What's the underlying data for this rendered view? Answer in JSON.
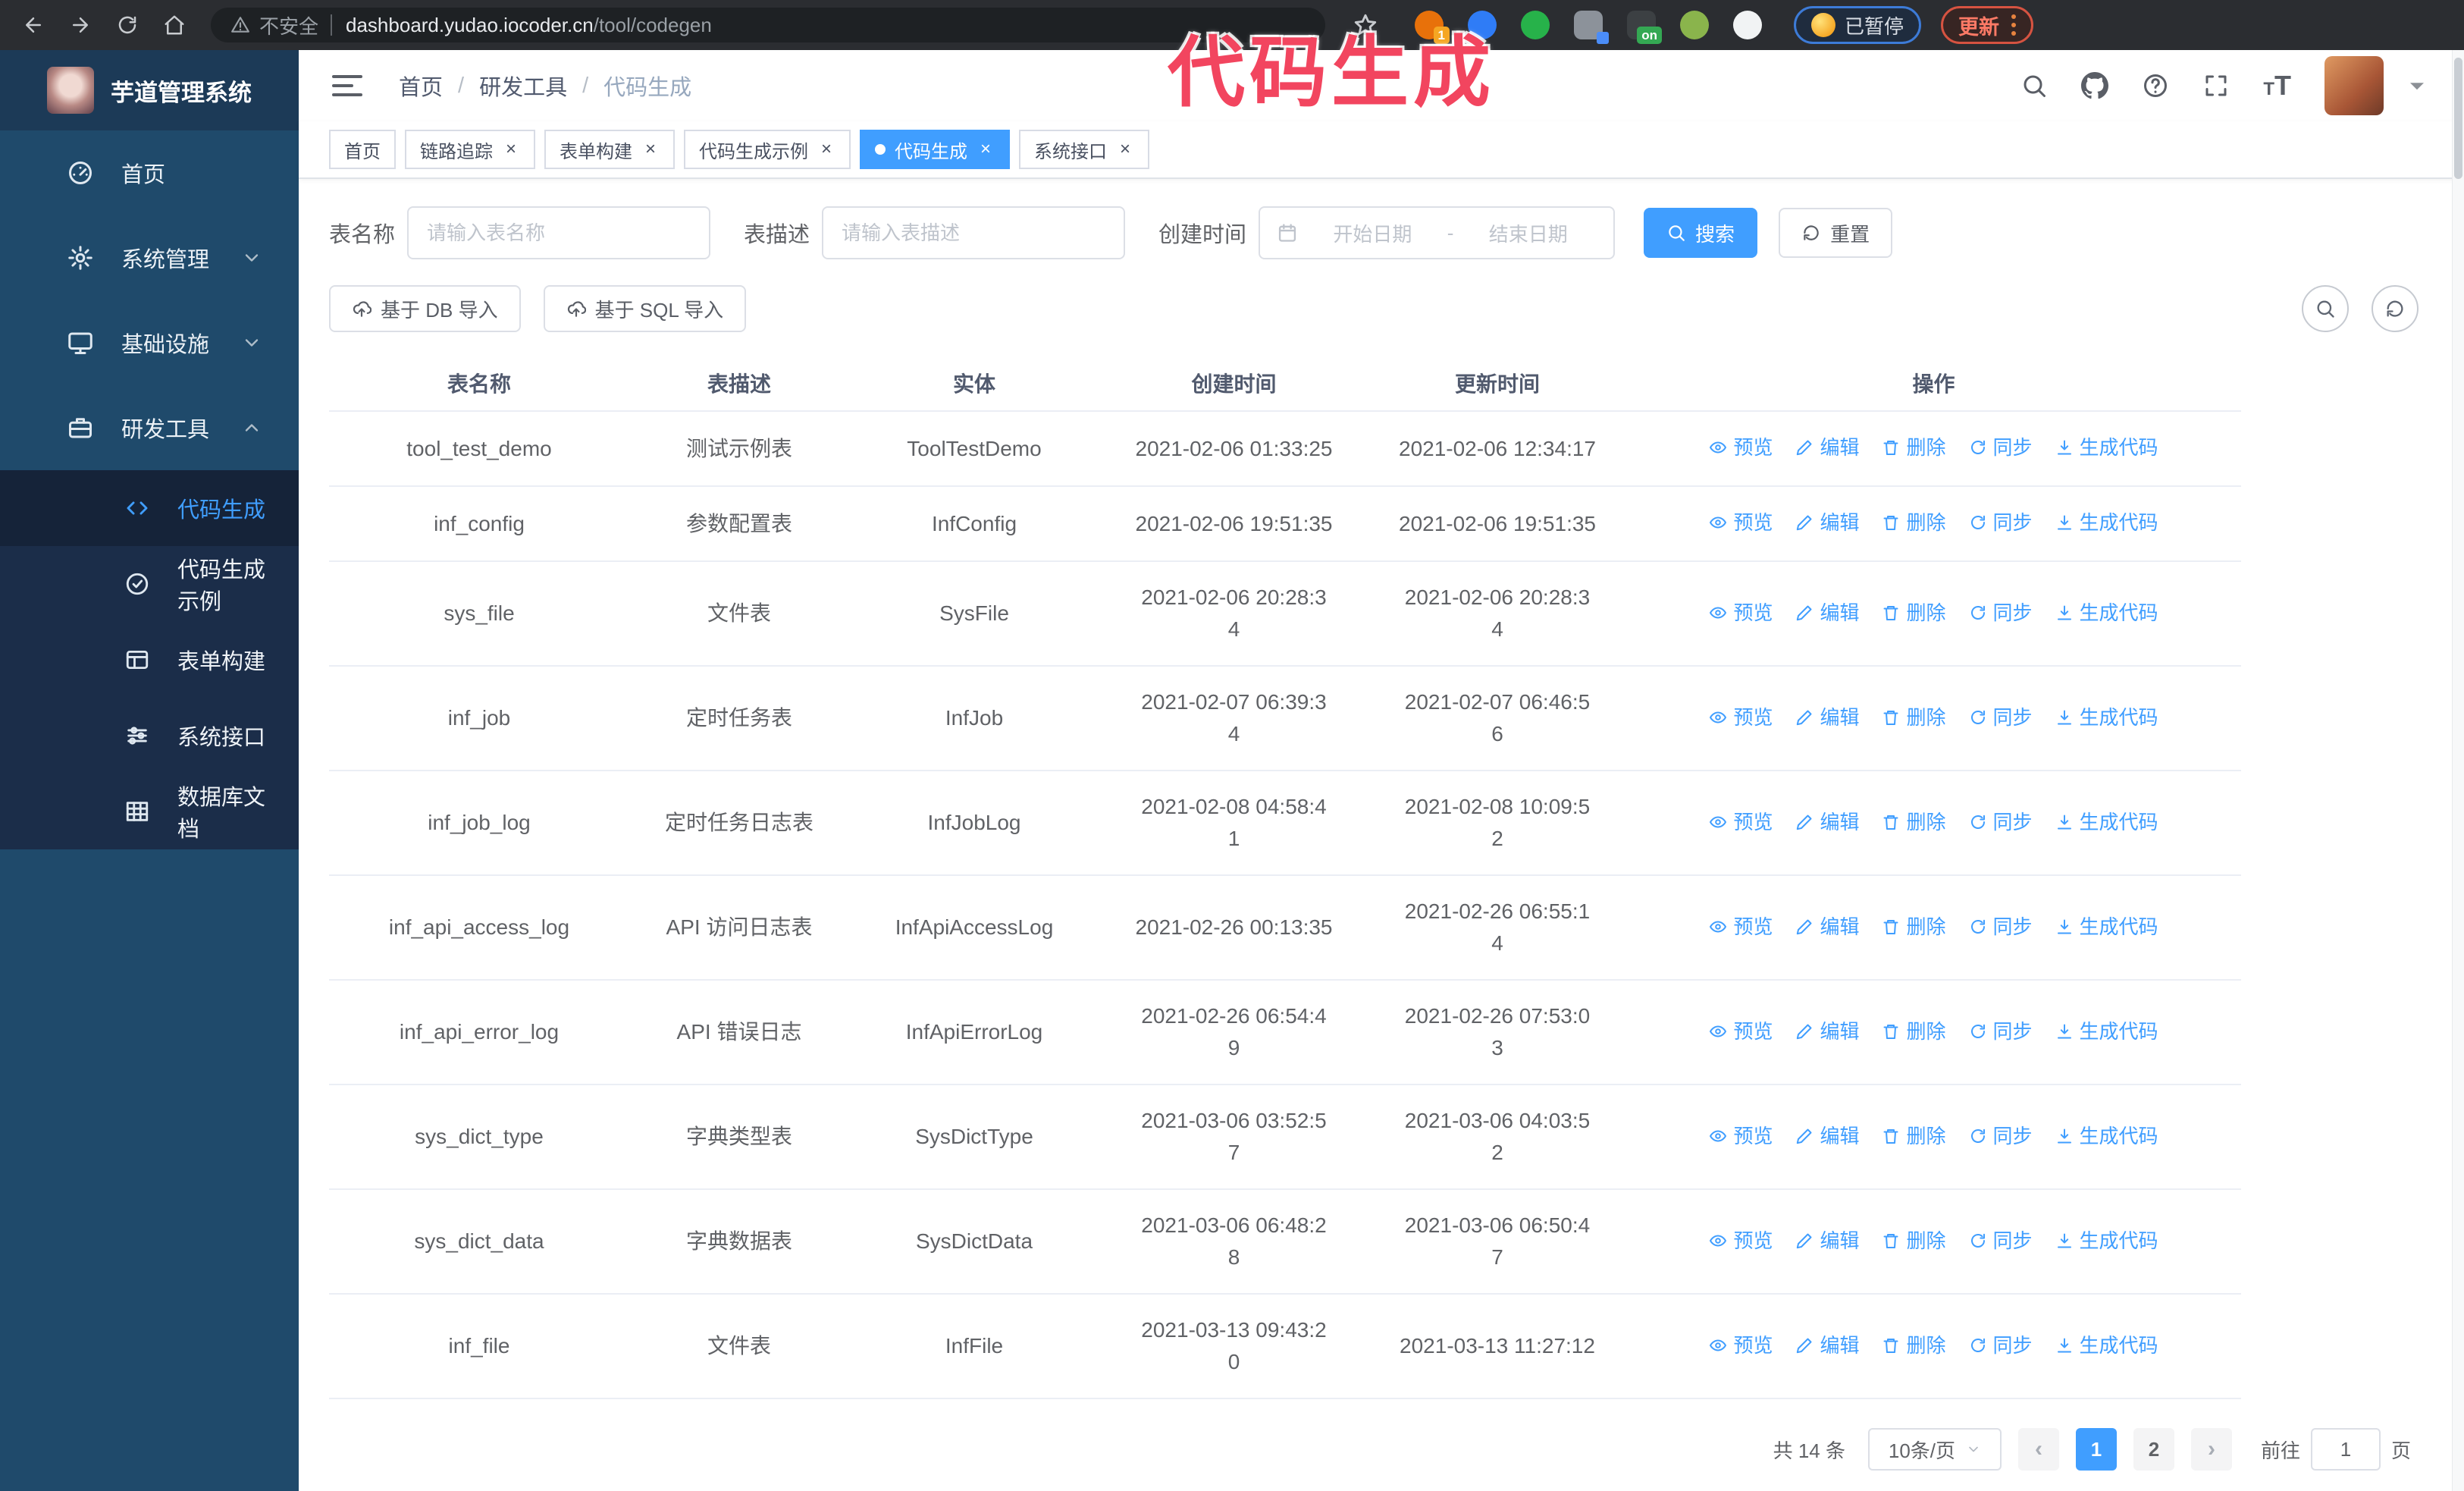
{
  "browser": {
    "security_label": "不安全",
    "url_domain": "dashboard.yudao.iocoder.cn",
    "url_path": "/tool/codegen",
    "paused_badge": "已暂停",
    "update_button": "更新",
    "extensions": [
      {
        "name": "browser-extension-orange-icon",
        "color": "#e8710a",
        "shape": "round",
        "badge": "1",
        "badge_color": "#f5a623"
      },
      {
        "name": "browser-extension-gem-icon",
        "color": "#2f7cf6",
        "shape": "round"
      },
      {
        "name": "browser-extension-green-circle-icon",
        "color": "#27b24a",
        "shape": "round"
      },
      {
        "name": "browser-extension-grid-icon",
        "color": "#8c929a",
        "shape": "square",
        "badge": "",
        "badge_color": "#4b8df8"
      },
      {
        "name": "browser-extension-dark-icon",
        "color": "#3c4043",
        "shape": "square",
        "badge": "on",
        "badge_color": "#34a853"
      },
      {
        "name": "browser-extension-green-monkey-icon",
        "color": "#8ab44c",
        "shape": "round"
      },
      {
        "name": "browser-extension-white-icon",
        "color": "#f1f3f4",
        "shape": "round"
      }
    ]
  },
  "overlay": {
    "text": "代码生成",
    "color": "#f2455f"
  },
  "app": {
    "logo_title": "芋道管理系统",
    "breadcrumb": [
      "首页",
      "研发工具",
      "代码生成"
    ],
    "sidebar": {
      "items": [
        {
          "label": "首页",
          "icon": "gauge-icon"
        },
        {
          "label": "系统管理",
          "icon": "gear-icon",
          "chevron": "down"
        },
        {
          "label": "基础设施",
          "icon": "monitor-icon",
          "chevron": "down"
        },
        {
          "label": "研发工具",
          "icon": "toolbox-icon",
          "chevron": "up",
          "children": [
            {
              "label": "代码生成",
              "icon": "code-icon",
              "active": true
            },
            {
              "label": "代码生成示例",
              "icon": "badge-check-icon"
            },
            {
              "label": "表单构建",
              "icon": "form-icon"
            },
            {
              "label": "系统接口",
              "icon": "sliders-icon"
            },
            {
              "label": "数据库文档",
              "icon": "table-grid-icon"
            }
          ]
        }
      ]
    },
    "tags": [
      {
        "label": "首页",
        "closable": false,
        "active": false
      },
      {
        "label": "链路追踪",
        "closable": true,
        "active": false
      },
      {
        "label": "表单构建",
        "closable": true,
        "active": false
      },
      {
        "label": "代码生成示例",
        "closable": true,
        "active": false
      },
      {
        "label": "代码生成",
        "closable": true,
        "active": true
      },
      {
        "label": "系统接口",
        "closable": true,
        "active": false
      }
    ],
    "search_form": {
      "table_name_label": "表名称",
      "table_name_placeholder": "请输入表名称",
      "table_desc_label": "表描述",
      "table_desc_placeholder": "请输入表描述",
      "create_time_label": "创建时间",
      "start_placeholder": "开始日期",
      "range_separator": "-",
      "end_placeholder": "结束日期",
      "search_button": "搜索",
      "reset_button": "重置"
    },
    "toolbar": {
      "import_db": "基于 DB 导入",
      "import_sql": "基于 SQL 导入"
    },
    "table": {
      "columns": [
        "表名称",
        "表描述",
        "实体",
        "创建时间",
        "更新时间",
        "操作"
      ],
      "actions": [
        {
          "label": "预览",
          "icon": "eye-icon"
        },
        {
          "label": "编辑",
          "icon": "edit-icon"
        },
        {
          "label": "删除",
          "icon": "trash-icon"
        },
        {
          "label": "同步",
          "icon": "sync-icon"
        },
        {
          "label": "生成代码",
          "icon": "download-icon"
        }
      ],
      "rows": [
        [
          "tool_test_demo",
          "测试示例表",
          "ToolTestDemo",
          "2021-02-06 01:33:25",
          "2021-02-06 12:34:17"
        ],
        [
          "inf_config",
          "参数配置表",
          "InfConfig",
          "2021-02-06 19:51:35",
          "2021-02-06 19:51:35"
        ],
        [
          "sys_file",
          "文件表",
          "SysFile",
          "2021-02-06 20:28:34",
          "2021-02-06 20:28:34"
        ],
        [
          "inf_job",
          "定时任务表",
          "InfJob",
          "2021-02-07 06:39:34",
          "2021-02-07 06:46:56"
        ],
        [
          "inf_job_log",
          "定时任务日志表",
          "InfJobLog",
          "2021-02-08 04:58:41",
          "2021-02-08 10:09:52"
        ],
        [
          "inf_api_access_log",
          "API 访问日志表",
          "InfApiAccessLog",
          "2021-02-26 00:13:35",
          "2021-02-26 06:55:14"
        ],
        [
          "inf_api_error_log",
          "API 错误日志",
          "InfApiErrorLog",
          "2021-02-26 06:54:49",
          "2021-02-26 07:53:03"
        ],
        [
          "sys_dict_type",
          "字典类型表",
          "SysDictType",
          "2021-03-06 03:52:57",
          "2021-03-06 04:03:52"
        ],
        [
          "sys_dict_data",
          "字典数据表",
          "SysDictData",
          "2021-03-06 06:48:28",
          "2021-03-06 06:50:47"
        ],
        [
          "inf_file",
          "文件表",
          "InfFile",
          "2021-03-13 09:43:20",
          "2021-03-13 11:27:12"
        ]
      ]
    },
    "pagination": {
      "total": "共 14 条",
      "page_size": "10条/页",
      "pages": [
        {
          "label": "1",
          "active": true
        },
        {
          "label": "2",
          "active": false
        }
      ],
      "goto_label": "前往",
      "goto_value": "1",
      "goto_suffix": "页"
    }
  },
  "colors": {
    "accent": "#409EFF",
    "sidebar_bg": "#1f4a6b",
    "submenu_bg": "#1b2d49",
    "overlay_pink": "#f2455f"
  }
}
